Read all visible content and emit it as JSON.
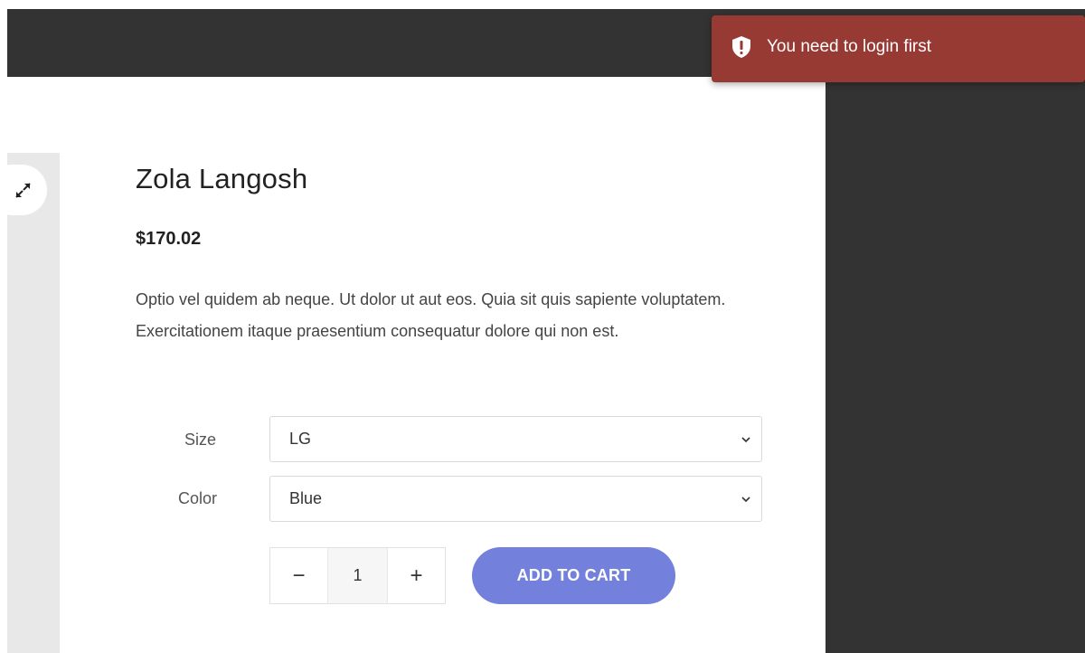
{
  "product": {
    "title": "Zola Langosh",
    "price": "$170.02",
    "description": "Optio vel quidem ab neque. Ut dolor ut aut eos. Quia sit quis sapiente voluptatem. Exercitationem itaque praesentium consequatur dolore qui non est."
  },
  "options": {
    "size": {
      "label": "Size",
      "selected": "LG"
    },
    "color": {
      "label": "Color",
      "selected": "Blue"
    }
  },
  "quantity": {
    "decrement": "−",
    "value": "1",
    "increment": "+"
  },
  "add_to_cart_label": "ADD TO CART",
  "toast": {
    "message": "You need to login first",
    "icon": "shield-alert-icon",
    "color": "#973a34"
  },
  "colors": {
    "accent": "#7380dc",
    "dark": "#333333"
  },
  "icons": {
    "expand": "expand-icon",
    "chevron": "chevron-down-icon"
  }
}
